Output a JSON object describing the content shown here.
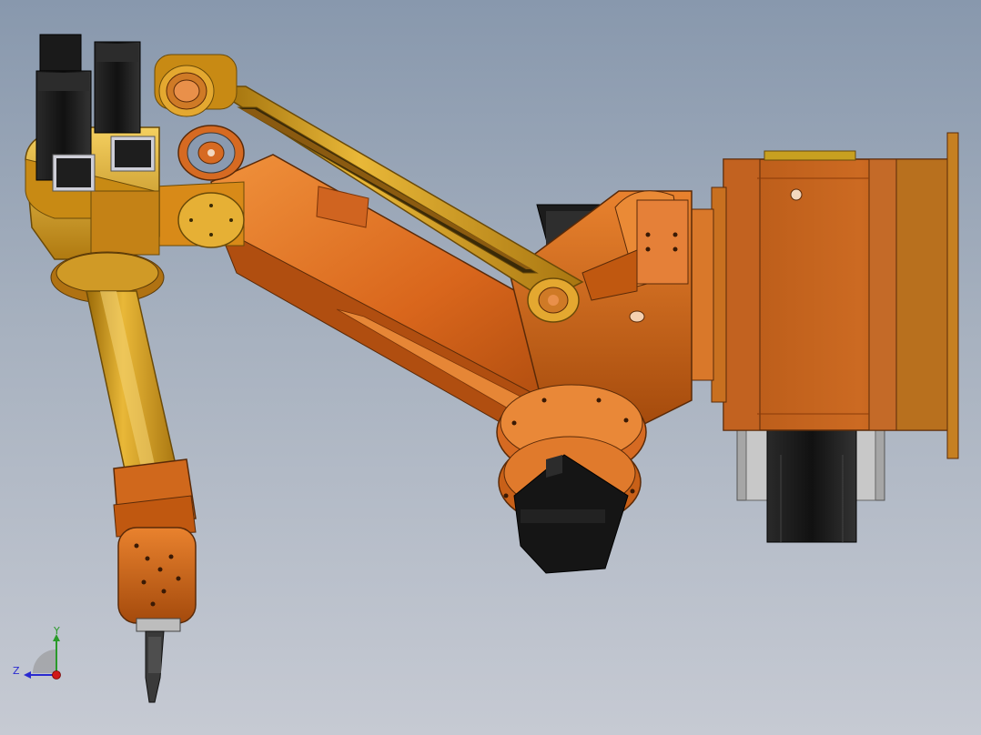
{
  "scene": {
    "background_top": "#8898ad",
    "background_bottom": "#c6cad3",
    "colors": {
      "orange": "#d9661c",
      "orange_dark": "#8f3a08",
      "orange_light": "#f3a050",
      "gold": "#c88a12",
      "gold_light": "#f0d060",
      "motor": "#1a1a1a",
      "bracket": "#aeaeae"
    }
  },
  "triad": {
    "y_label": "Y",
    "z_label": "Z",
    "y_color": "#2a9a2a",
    "z_color": "#2a2ad0",
    "origin_color": "#d01818",
    "icons": [
      "y-axis-arrow-icon",
      "z-axis-arrow-icon",
      "origin-point-icon"
    ]
  }
}
